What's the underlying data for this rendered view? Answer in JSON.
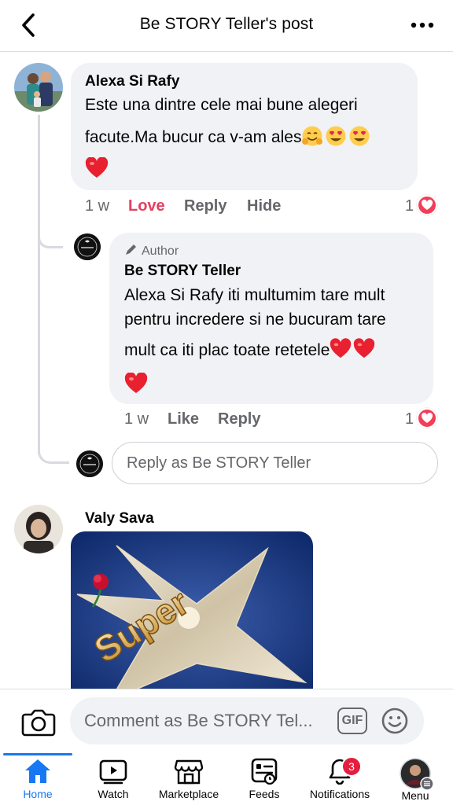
{
  "header": {
    "title": "Be STORY Teller's post"
  },
  "comments": [
    {
      "author": "Alexa Si Rafy",
      "text_line1": "Este una dintre cele mai bune alegeri",
      "text_line2": "facute.Ma bucur ca v-am ales",
      "time": "1 w",
      "action_love": "Love",
      "action_reply": "Reply",
      "action_hide": "Hide",
      "reaction_count": "1",
      "reply": {
        "badge": "Author",
        "author": "Be STORY Teller",
        "text_line1": "Alexa Si Rafy iti multumim tare mult",
        "text_line2": "pentru incredere si ne bucuram tare",
        "text_line3": "mult ca iti plac toate retetele",
        "time": "1 w",
        "action_like": "Like",
        "action_reply": "Reply",
        "reaction_count": "1"
      },
      "reply_placeholder": "Reply as Be STORY Teller"
    },
    {
      "author": "Valy Sava",
      "sticker_text": "Super"
    }
  ],
  "composer": {
    "placeholder": "Comment as Be STORY Tel...",
    "gif_label": "GIF"
  },
  "tabs": [
    {
      "label": "Home",
      "active": true
    },
    {
      "label": "Watch"
    },
    {
      "label": "Marketplace"
    },
    {
      "label": "Feeds"
    },
    {
      "label": "Notifications",
      "badge": "3"
    },
    {
      "label": "Menu"
    }
  ],
  "colors": {
    "accent": "#1877f2",
    "love": "#e4405f",
    "heart": "#f33e58",
    "bubble": "#f0f2f5",
    "muted": "#65676b"
  }
}
